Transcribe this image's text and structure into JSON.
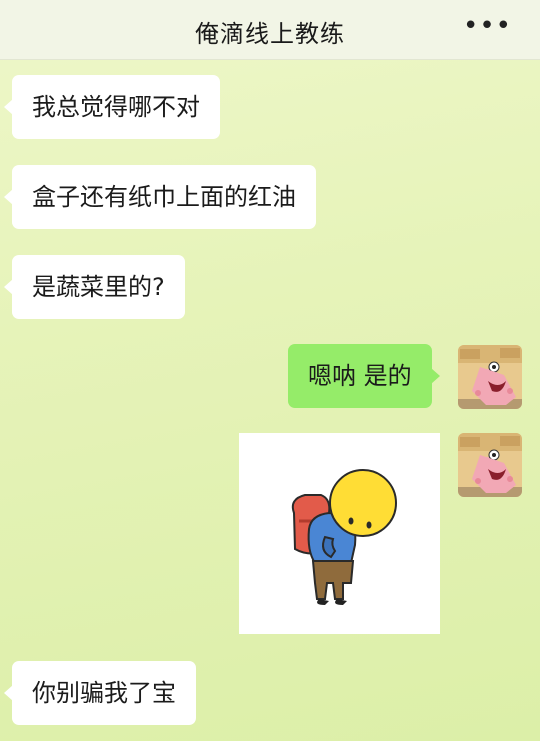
{
  "header": {
    "title": "俺滴线上教练",
    "more_glyph": "•••"
  },
  "messages": [
    {
      "side": "left",
      "text": "我总觉得哪不对"
    },
    {
      "side": "left",
      "text": "盒子还有纸巾上面的红油"
    },
    {
      "side": "left",
      "text": "是蔬菜里的?"
    },
    {
      "side": "right",
      "text": "嗯呐 是的"
    },
    {
      "side": "right",
      "type": "sticker",
      "sticker": "bowing-emoji-sticker"
    },
    {
      "side": "left",
      "text": "你别骗我了宝"
    }
  ],
  "colors": {
    "right_bubble": "#95ec69",
    "left_bubble": "#ffffff",
    "background": "#e6f3b9"
  },
  "icons": {
    "more": "more-dots-icon",
    "avatar": "patrick-star-avatar"
  }
}
